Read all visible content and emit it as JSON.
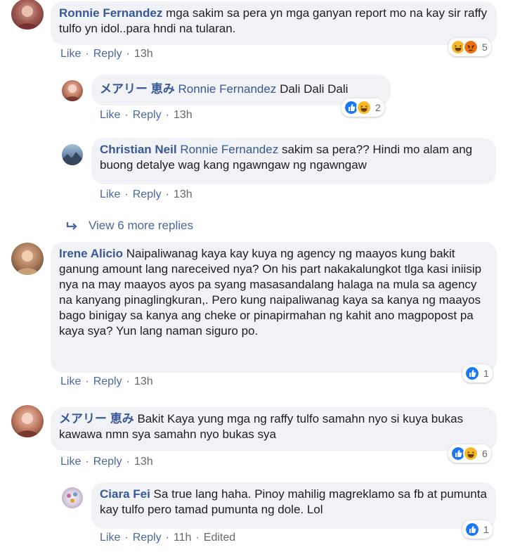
{
  "comments": [
    {
      "author": "Ronnie Fernandez",
      "text": "mga sakim sa pera yn mga ganyan report mo na kay sir raffy tulfo yn idol..para hndi na tularan.",
      "like": "Like",
      "reply": "Reply",
      "time": "13h",
      "reaction_icons": [
        "haha-icon",
        "angry-icon"
      ],
      "reaction_count": "5"
    },
    {
      "author": "メアリー 恵み",
      "mention": "Ronnie Fernandez",
      "text": "Dali Dali Dali",
      "like": "Like",
      "reply": "Reply",
      "time": "13h",
      "reaction_icons": [
        "like-icon",
        "haha-icon"
      ],
      "reaction_count": "2"
    },
    {
      "author": "Christian Neil",
      "mention": "Ronnie Fernandez",
      "text": "sakim sa pera?? Hindi mo alam ang buong detalye wag kang ngawngaw ng ngawngaw",
      "like": "Like",
      "reply": "Reply",
      "time": "13h"
    },
    {
      "author": "Irene Alicio",
      "text": "Naipaliwanag kaya kay kuya ng agency ng maayos kung bakit ganung amount lang nareceived nya? On his part nakakalungkot tlga kasi iniisip nya na may maayos ayos pa syang masasandalang halaga na mula sa agency na kanyang pinaglingkuran,. Pero kung naipaliwanag kaya sa kanya ng maayos bago binigay sa kanya ang cheke or pinapirmahan ng kahit ano magpopost pa kaya sya? Yun lang naman siguro po.",
      "like": "Like",
      "reply": "Reply",
      "time": "13h",
      "reaction_icons": [
        "like-icon"
      ],
      "reaction_count": "1"
    },
    {
      "author": "メアリー 恵み",
      "text": "Bakit Kaya yung mga ng raffy tulfo samahn nyo si kuya bukas kawawa nmn sya samahn nyo bukas sya",
      "like": "Like",
      "reply": "Reply",
      "time": "13h",
      "reaction_icons": [
        "like-icon",
        "haha-icon"
      ],
      "reaction_count": "6"
    },
    {
      "author": "Ciara Fei",
      "text": "Sa true lang haha. Pinoy mahilig magreklamo sa fb at pumunta kay tulfo pero tamad pumunta ng dole. Lol",
      "like": "Like",
      "reply": "Reply",
      "time": "11h",
      "edited": "Edited",
      "reaction_icons": [
        "like-icon"
      ],
      "reaction_count": "1"
    }
  ],
  "view_more_replies": "View 6 more replies",
  "colors": {
    "author": "#385898",
    "bubble": "#f0f2f5",
    "like_blue": "#1877f2",
    "haha_yellow": "#f7b928",
    "angry_orange": "#e9710f"
  }
}
